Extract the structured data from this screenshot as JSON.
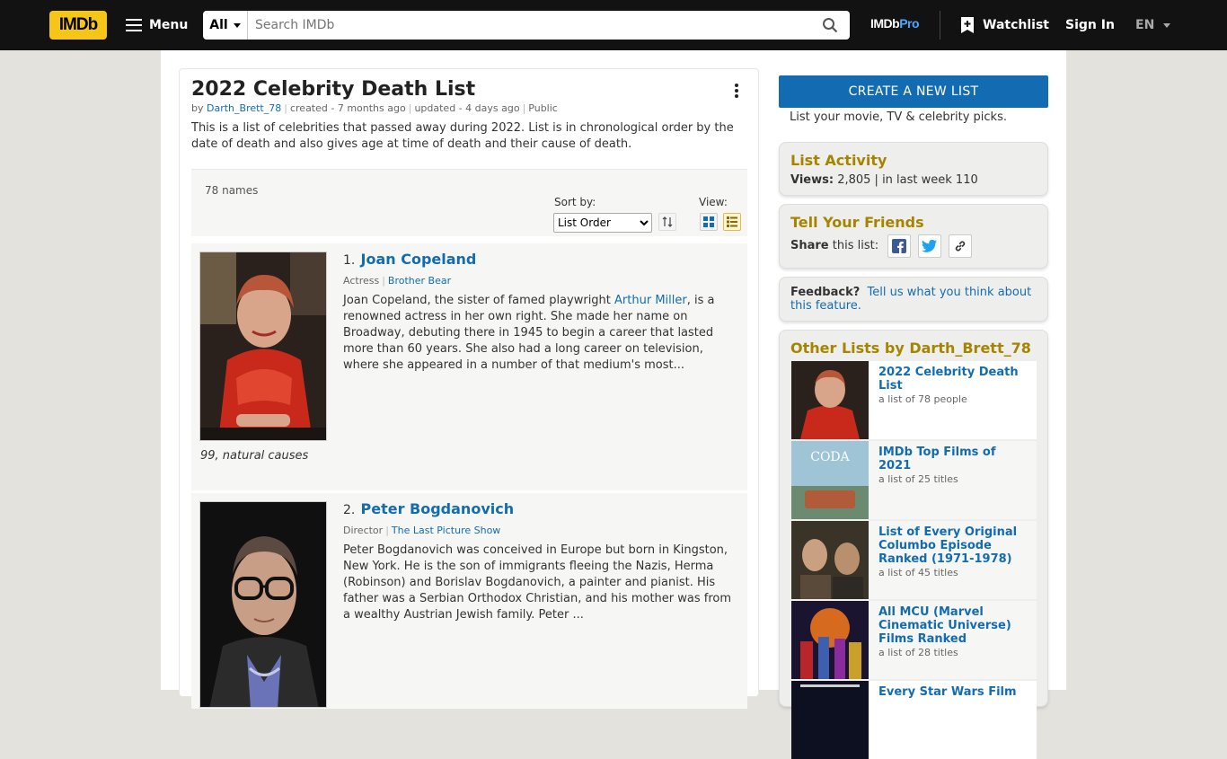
{
  "nav": {
    "logo": "IMDb",
    "menu_label": "Menu",
    "search_category": "All",
    "search_placeholder": "Search IMDb",
    "imdbpro_a": "IMDb",
    "imdbpro_b": "Pro",
    "watchlist_label": "Watchlist",
    "signin_label": "Sign In",
    "language": "EN"
  },
  "list": {
    "title": "2022 Celebrity Death List",
    "by_prefix": "by",
    "author": "Darth_Brett_78",
    "created": "created - 7 months ago",
    "updated": "updated - 4 days ago",
    "visibility": "Public",
    "description": "This is a list of celebrities that passed away during 2022. List is in chronological order by the date of death and also gives age at time of death and their cause of death.",
    "count": "78 names",
    "sort_label": "Sort by:",
    "sort_value": "List Order",
    "view_label": "View:"
  },
  "items": [
    {
      "number": "1.",
      "name": "Joan Copeland",
      "role": "Actress",
      "known_for": "Brother Bear",
      "bio_before": "Joan Copeland, the sister of famed playwright ",
      "bio_link": "Arthur Miller",
      "bio_after": ", is a renowned actress in her own right. She made her name on Broadway, debuting there in 1945 to begin a career that lasted more than 60 years. She also had a long career on television, where she appeared in a number of that medium's most...",
      "caption": "99, natural causes"
    },
    {
      "number": "2.",
      "name": "Peter Bogdanovich",
      "role": "Director",
      "known_for": "The Last Picture Show",
      "bio": "Peter Bogdanovich was conceived in Europe but born in Kingston, New York. He is the son of immigrants fleeing the Nazis, Herma (Robinson) and Borislav Bogdanovich, a painter and pianist. His father was a Serbian Orthodox Christian, and his mother was from a wealthy Austrian Jewish family. Peter ..."
    }
  ],
  "sidebar": {
    "create_button": "CREATE A NEW LIST",
    "create_sub": "List your movie, TV & celebrity picks.",
    "activity_title": "List Activity",
    "views_label": "Views:",
    "views_value": "2,805 | in last week 110",
    "friends_title": "Tell Your Friends",
    "share_label": "Share",
    "share_rest": "this list:",
    "feedback_label": "Feedback?",
    "feedback_link": "Tell us what you think about this feature.",
    "other_title": "Other Lists by Darth_Brett_78",
    "other_lists": [
      {
        "title": "2022 Celebrity Death List",
        "sub": "a list of 78 people"
      },
      {
        "title": "IMDb Top Films of 2021",
        "sub": "a list of 25 titles",
        "thumb_text": "CODA"
      },
      {
        "title": "List of Every Original Columbo Episode Ranked (1971-1978)",
        "sub": "a list of 45 titles"
      },
      {
        "title": "All MCU (Marvel Cinematic Universe) Films Ranked",
        "sub": "a list of 28 titles"
      },
      {
        "title": "Every Star Wars Film"
      }
    ]
  }
}
